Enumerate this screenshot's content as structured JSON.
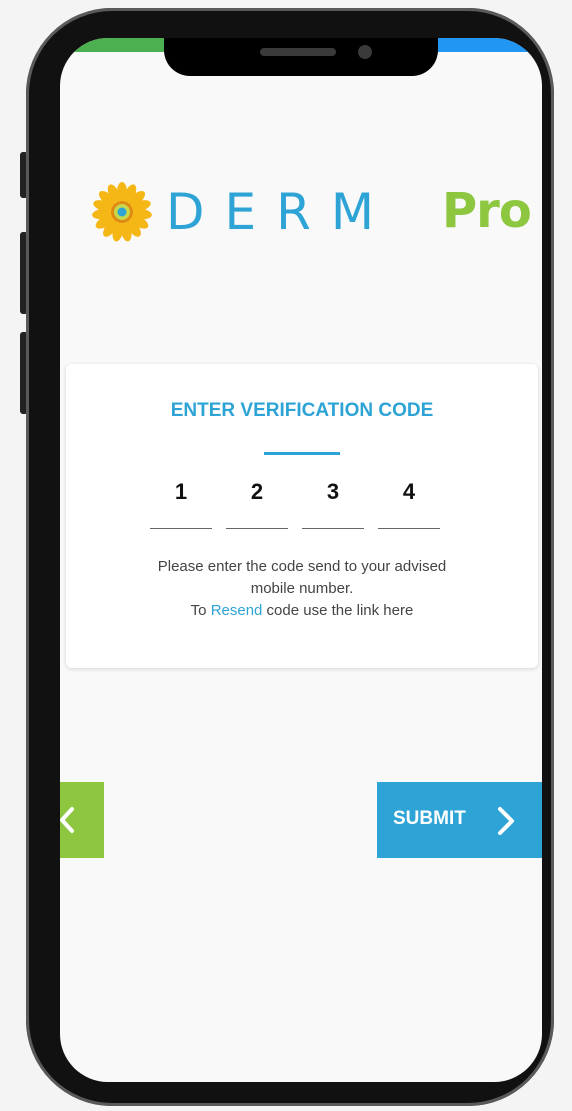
{
  "logo": {
    "brand_main": "DERM",
    "brand_suffix": "Pro"
  },
  "card": {
    "title": "ENTER VERIFICATION CODE",
    "code_digits": [
      "1",
      "2",
      "3",
      "4"
    ],
    "help_line1": "Please enter the code send to your advised",
    "help_line2": "mobile number.",
    "help_prefix": "To ",
    "resend_link": "Resend",
    "help_suffix": " code use the link here"
  },
  "actions": {
    "submit_label": "SUBMIT"
  },
  "colors": {
    "accent_blue": "#2ea3d6",
    "accent_green": "#8dc63f"
  },
  "icons": {
    "back": "chevron-left-icon",
    "submit": "chevron-right-icon",
    "logo": "sunflower-icon"
  }
}
